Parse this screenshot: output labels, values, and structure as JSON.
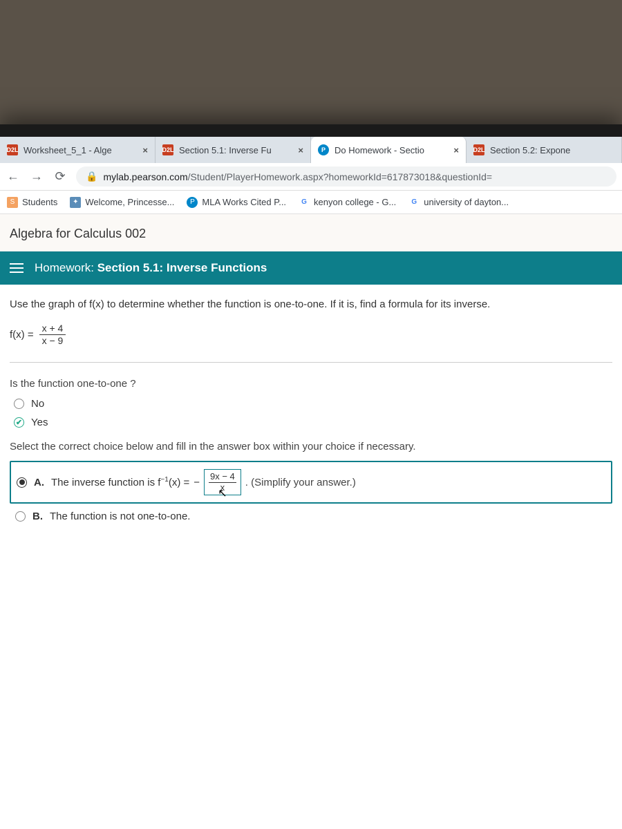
{
  "tabs": [
    {
      "favicon": "D2L",
      "title": "Worksheet_5_1 - Alge"
    },
    {
      "favicon": "D2L",
      "title": "Section 5.1: Inverse Fu"
    },
    {
      "favicon": "P",
      "title": "Do Homework - Sectio",
      "active": true
    },
    {
      "favicon": "D2L",
      "title": "Section 5.2: Expone"
    }
  ],
  "url": {
    "domain": "mylab.pearson.com",
    "path": "/Student/PlayerHomework.aspx?homeworkId=617873018&questionId="
  },
  "bookmarks": [
    {
      "label": "Students"
    },
    {
      "label": "Welcome, Princesse..."
    },
    {
      "label": "MLA Works Cited P..."
    },
    {
      "label": "kenyon college - G..."
    },
    {
      "label": "university of dayton..."
    }
  ],
  "course_title": "Algebra for Calculus 002",
  "hw": {
    "prefix": "Homework:",
    "title": "Section 5.1: Inverse Functions"
  },
  "problem": {
    "instruction": "Use the graph of f(x) to determine whether the function is one-to-one. If it is, find a formula for its inverse.",
    "fx_left": "f(x) =",
    "fx_num": "x + 4",
    "fx_den": "x − 9",
    "q1": "Is the function one-to-one ?",
    "q1_options": {
      "no": "No",
      "yes": "Yes"
    },
    "instruct2": "Select the correct choice below and fill in the answer box within your choice if necessary.",
    "optA": {
      "letter": "A.",
      "text_before": "The inverse function is f",
      "exponent": "−1",
      "text_after": "(x) =",
      "minus": "−",
      "box_num": "9x − 4",
      "box_den": "x",
      "hint": ". (Simplify your answer.)"
    },
    "optB": {
      "letter": "B.",
      "text": "The function is not one-to-one."
    }
  }
}
